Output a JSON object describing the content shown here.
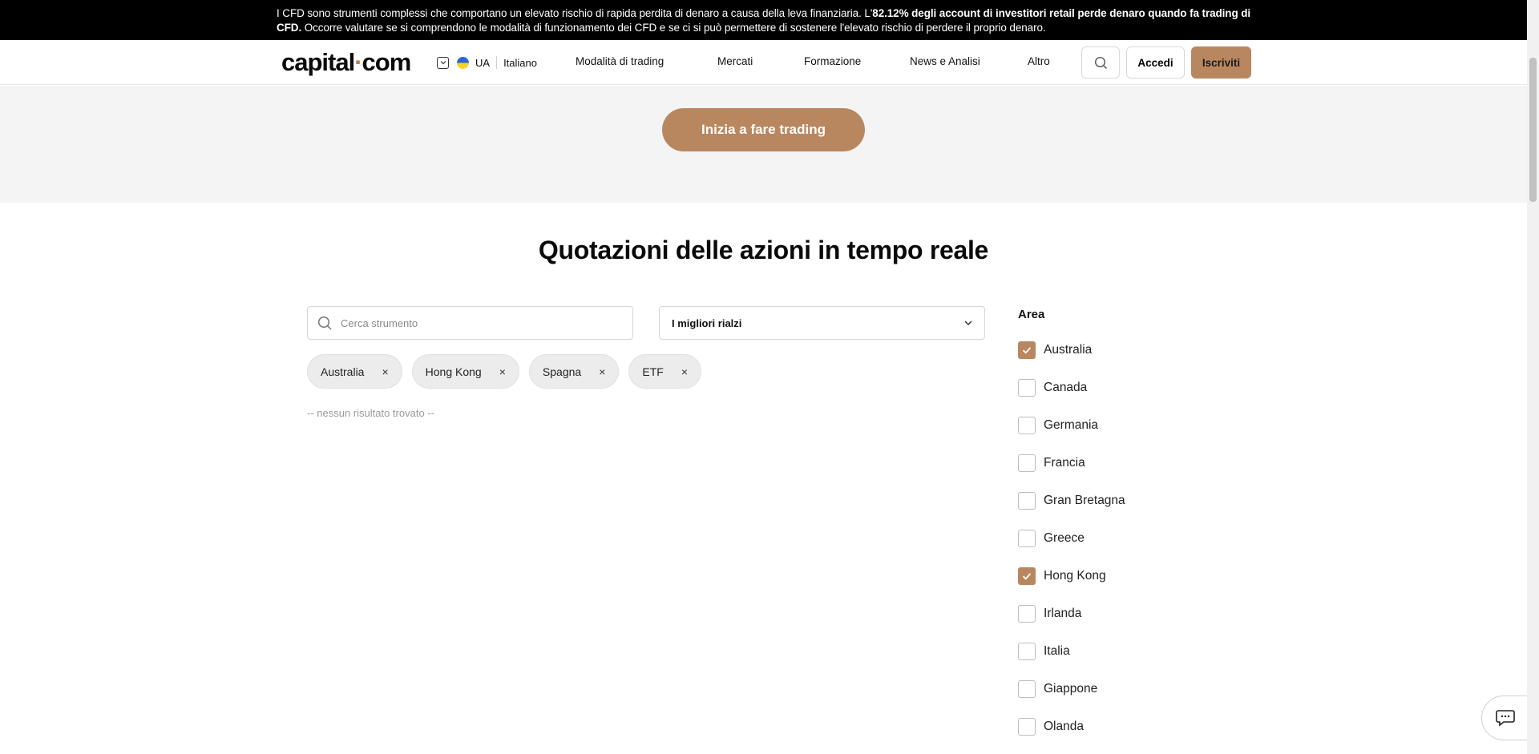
{
  "risk_warning": {
    "part1": "I CFD sono strumenti complessi che comportano un elevato rischio di rapida perdita di denaro a causa della leva finanziaria. L'",
    "bold": "82.12% degli account di investitori retail perde denaro quando fa trading di CFD.",
    "part2": " Occorre valutare se si comprendono le modalità di funzionamento dei CFD e se ci si può permettere di sostenere l'elevato rischio di perdere il proprio denaro."
  },
  "header": {
    "logo_left": "capital",
    "logo_dot": "·",
    "logo_right": "com",
    "region": "UA",
    "language": "Italiano",
    "nav": [
      "Modalità di trading",
      "Mercati",
      "Formazione",
      "News e Analisi",
      "Altro"
    ],
    "login_label": "Accedi",
    "signup_label": "Iscriviti"
  },
  "hero": {
    "cta_label": "Inizia a fare trading"
  },
  "main": {
    "title": "Quotazioni delle azioni in tempo reale",
    "search_placeholder": "Cerca strumento",
    "sort_selected": "I migliori rialzi",
    "chips": [
      "Australia",
      "Hong Kong",
      "Spagna",
      "ETF"
    ],
    "chip_remove_symbol": "×",
    "no_results": "-- nessun risultato trovato --"
  },
  "filter": {
    "title": "Area",
    "items": [
      {
        "label": "Australia",
        "checked": true
      },
      {
        "label": "Canada",
        "checked": false
      },
      {
        "label": "Germania",
        "checked": false
      },
      {
        "label": "Francia",
        "checked": false
      },
      {
        "label": "Gran Bretagna",
        "checked": false
      },
      {
        "label": "Greece",
        "checked": false
      },
      {
        "label": "Hong Kong",
        "checked": true
      },
      {
        "label": "Irlanda",
        "checked": false
      },
      {
        "label": "Italia",
        "checked": false
      },
      {
        "label": "Giappone",
        "checked": false
      },
      {
        "label": "Olanda",
        "checked": false
      }
    ]
  },
  "colors": {
    "accent": "#b9875f",
    "risk_bar_bg": "#000000",
    "hero_bg": "#f4f4f4"
  }
}
